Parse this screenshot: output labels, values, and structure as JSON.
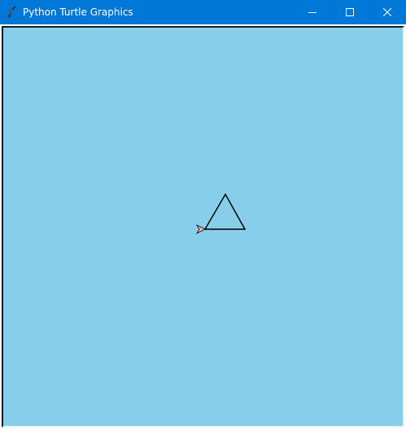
{
  "window": {
    "title": "Python Turtle Graphics",
    "icon": "feather-icon",
    "controls": [
      "minimize-icon",
      "maximize-icon",
      "close-icon"
    ]
  },
  "canvas": {
    "background_color": "#87ceeb",
    "shape": "equilateral triangle",
    "pen_color": "#000000",
    "turtle_fill_color": "#ffb6c1"
  }
}
